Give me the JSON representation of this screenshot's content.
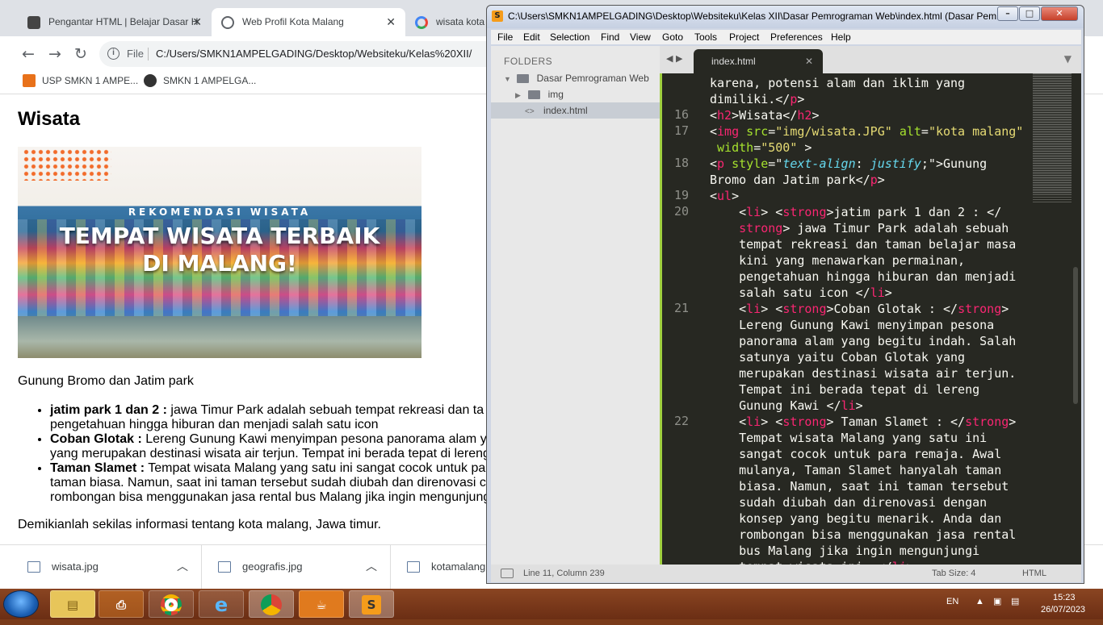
{
  "browser": {
    "tabs": [
      {
        "title": "Pengantar HTML | Belajar Dasar H",
        "close": "✕"
      },
      {
        "title": "Web Profil Kota Malang",
        "close": "✕"
      },
      {
        "title": "wisata kota"
      }
    ],
    "address": {
      "scheme_label": "File",
      "url": "C:/Users/SMKN1AMPELGADING/Desktop/Websiteku/Kelas%20XII/"
    },
    "bookmarks": [
      {
        "label": "USP SMKN 1 AMPE..."
      },
      {
        "label": "SMKN 1 AMPELGA..."
      }
    ]
  },
  "page": {
    "heading": "Wisata",
    "hero": {
      "subtitle": "REKOMENDASI WISATA",
      "title_line1": "TEMPAT WISATA TERBAIK",
      "title_line2": "DI MALANG!"
    },
    "intro": "Gunung Bromo dan Jatim park",
    "items": [
      {
        "strong": "jatim park 1 dan 2 :",
        "line1": " jawa Timur Park adalah sebuah tempat rekreasi dan ta",
        "line2": "pengetahuan hingga hiburan dan menjadi salah satu icon"
      },
      {
        "strong": "Coban Glotak :",
        "line1": " Lereng Gunung Kawi menyimpan pesona panorama alam y",
        "line2": "yang merupakan destinasi wisata air terjun. Tempat ini berada tepat di lereng"
      },
      {
        "strong": "Taman Slamet :",
        "line1": " Tempat wisata Malang yang satu ini sangat cocok untuk pa",
        "line2": "taman biasa. Namun, saat ini taman tersebut sudah diubah dan direnovasi c",
        "line3": "rombongan bisa menggunakan jasa rental bus Malang jika ingin mengunjung"
      }
    ],
    "closing": "Demikianlah sekilas informasi tentang kota malang, Jawa timur."
  },
  "downloads": [
    {
      "name": "wisata.jpg"
    },
    {
      "name": "geografis.jpg"
    },
    {
      "name": "kotamalang."
    }
  ],
  "sublime": {
    "title": "C:\\Users\\SMKN1AMPELGADING\\Desktop\\Websiteku\\Kelas XII\\Dasar Pemrograman Web\\index.html (Dasar Pem...",
    "menu": [
      "File",
      "Edit",
      "Selection",
      "Find",
      "View",
      "Goto",
      "Tools",
      "Project",
      "Preferences",
      "Help"
    ],
    "sidebar": {
      "header": "FOLDERS",
      "root": "Dasar Pemrograman Web",
      "folder": "img",
      "file": "index.html"
    },
    "tab": {
      "name": "index.html",
      "close": "✕"
    },
    "line_numbers": [
      "16",
      "17",
      "18",
      "19",
      "20",
      "21",
      "22"
    ],
    "status": {
      "position": "Line 11, Column 239",
      "tab_size": "Tab Size: 4",
      "syntax": "HTML"
    }
  },
  "taskbar": {
    "lang": "EN",
    "time": "15:23",
    "date": "26/07/2023"
  },
  "colors": {
    "editor_bg": "#272822",
    "tag": "#f92672",
    "attr": "#a6e22e",
    "string": "#e6db74",
    "taskbar": "#6b2e14"
  }
}
